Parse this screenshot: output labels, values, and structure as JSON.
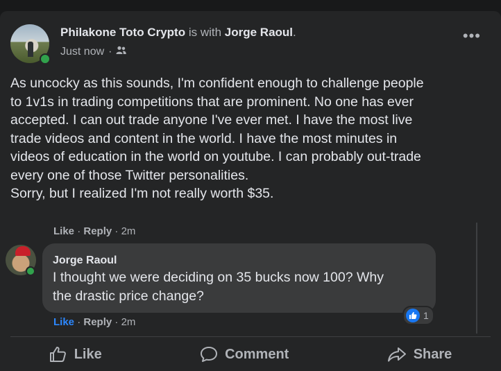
{
  "post": {
    "author": "Philakone Toto Crypto",
    "with_text": "is with",
    "tagged": "Jorge Raoul",
    "tagged_end": ".",
    "time": "Just now",
    "privacy_icon": "friends-icon",
    "text": "As uncocky as this sounds, I'm confident enough to challenge people\nto 1v1s in trading competitions that are prominent. No one has ever\naccepted. I can out trade anyone I've ever met. I have the most live\ntrade videos and content in the world. I have the most minutes in\nvideos of education in the world on youtube. I can probably out-trade\nevery one of those Twitter personalities.\nSorry, but I realized I'm not really worth $35."
  },
  "post_actions": {
    "like": "Like",
    "reply": "Reply",
    "separator": "·",
    "time": "2m"
  },
  "comment": {
    "author": "Jorge Raoul",
    "text": "I thought we were deciding on 35 bucks now 100? Why\nthe drastic price change?",
    "reaction_count": "1",
    "like": "Like",
    "reply": "Reply",
    "separator": "·",
    "time": "2m"
  },
  "action_bar": {
    "like": "Like",
    "comment": "Comment",
    "share": "Share"
  },
  "colors": {
    "background": "#18191a",
    "card": "#242526",
    "bubble": "#3a3b3c",
    "like_blue": "#2d88ff",
    "online_green": "#31a24c"
  }
}
